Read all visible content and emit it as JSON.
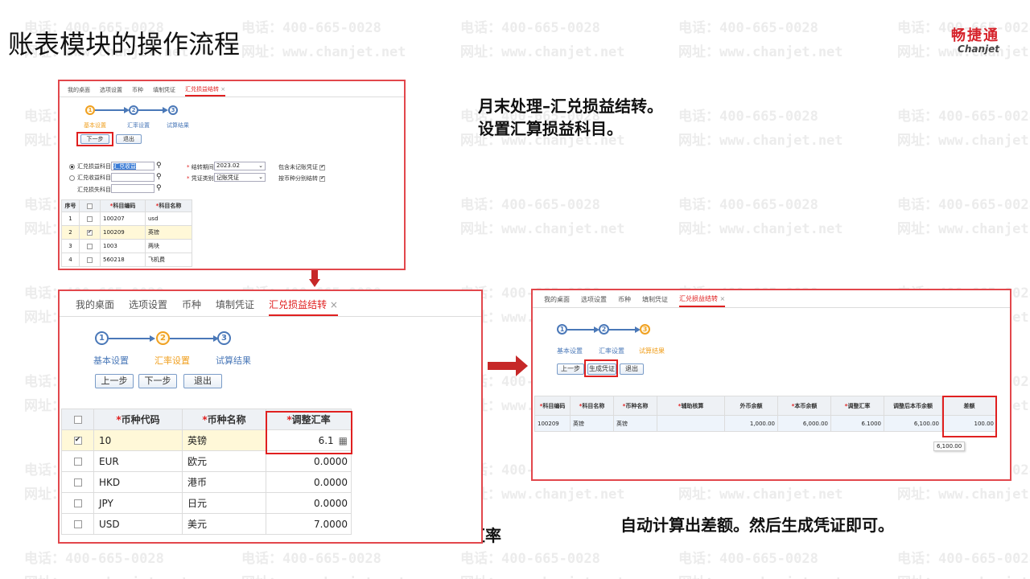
{
  "slide_title": "账表模块的操作流程",
  "logo": {
    "cn": "畅捷通",
    "en": "Chanjet"
  },
  "watermark": {
    "phone": "电话：400-665-0028",
    "site": "网址：www.chanjet.net"
  },
  "annotations": {
    "top_right_line1": "月末处理–汇兑损益结转。",
    "top_right_line2": "设置汇算损益科目。",
    "middle": "录入调整汇率",
    "right": "自动计算出差额。然后生成凭证即可。"
  },
  "tabs": [
    "我的桌面",
    "选项设置",
    "币种",
    "填制凭证",
    "汇兑损益结转"
  ],
  "close_glyph": "×",
  "steps": [
    {
      "num": "1",
      "label": "基本设置"
    },
    {
      "num": "2",
      "label": "汇率设置"
    },
    {
      "num": "3",
      "label": "试算结果"
    }
  ],
  "buttons": {
    "prev": "上一步",
    "next": "下一步",
    "exit": "退出",
    "gen_voucher": "生成凭证"
  },
  "panel1": {
    "radio_options": [
      "汇兑损益科目",
      "汇兑收益科目",
      "汇兑损失科目"
    ],
    "gain_loss_account_value": "汇兑收益",
    "period_label": "结转期间",
    "period_value": "2023.02",
    "voucher_type_label": "凭证类别",
    "voucher_type_value": "记账凭证",
    "include_unposted": "包含未记账凭证",
    "by_currency": "按币种分别结转",
    "table": {
      "headers": [
        "序号",
        "",
        "科目编码",
        "科目名称"
      ],
      "rows": [
        {
          "seq": "1",
          "code": "100207",
          "name": "usd",
          "checked": false
        },
        {
          "seq": "2",
          "code": "100209",
          "name": "英镑",
          "checked": true
        },
        {
          "seq": "3",
          "code": "1003",
          "name": "两块",
          "checked": false
        },
        {
          "seq": "4",
          "code": "560218",
          "name": "飞机费",
          "checked": false
        }
      ]
    }
  },
  "panel2": {
    "table": {
      "headers": [
        "",
        "币种代码",
        "币种名称",
        "调整汇率"
      ],
      "rows": [
        {
          "code": "10",
          "name": "英镑",
          "rate": "6.1",
          "checked": true
        },
        {
          "code": "EUR",
          "name": "欧元",
          "rate": "0.0000",
          "checked": false
        },
        {
          "code": "HKD",
          "name": "港币",
          "rate": "0.0000",
          "checked": false
        },
        {
          "code": "JPY",
          "name": "日元",
          "rate": "0.0000",
          "checked": false
        },
        {
          "code": "USD",
          "name": "美元",
          "rate": "7.0000",
          "checked": false
        }
      ]
    }
  },
  "panel3": {
    "table": {
      "headers": [
        "科目编码",
        "科目名称",
        "币种名称",
        "辅助核算",
        "外币余额",
        "本币余额",
        "调整汇率",
        "调整后本币余额",
        "差额"
      ],
      "row": [
        "100209",
        "英镑",
        "英镑",
        "",
        "1,000.00",
        "6,000.00",
        "6.1000",
        "6,100.00",
        "100.00"
      ]
    },
    "tooltip": "6,100.00"
  },
  "colors": {
    "accent_red": "#e02020",
    "step_blue": "#4a78b8",
    "step_current": "#f0a020"
  }
}
